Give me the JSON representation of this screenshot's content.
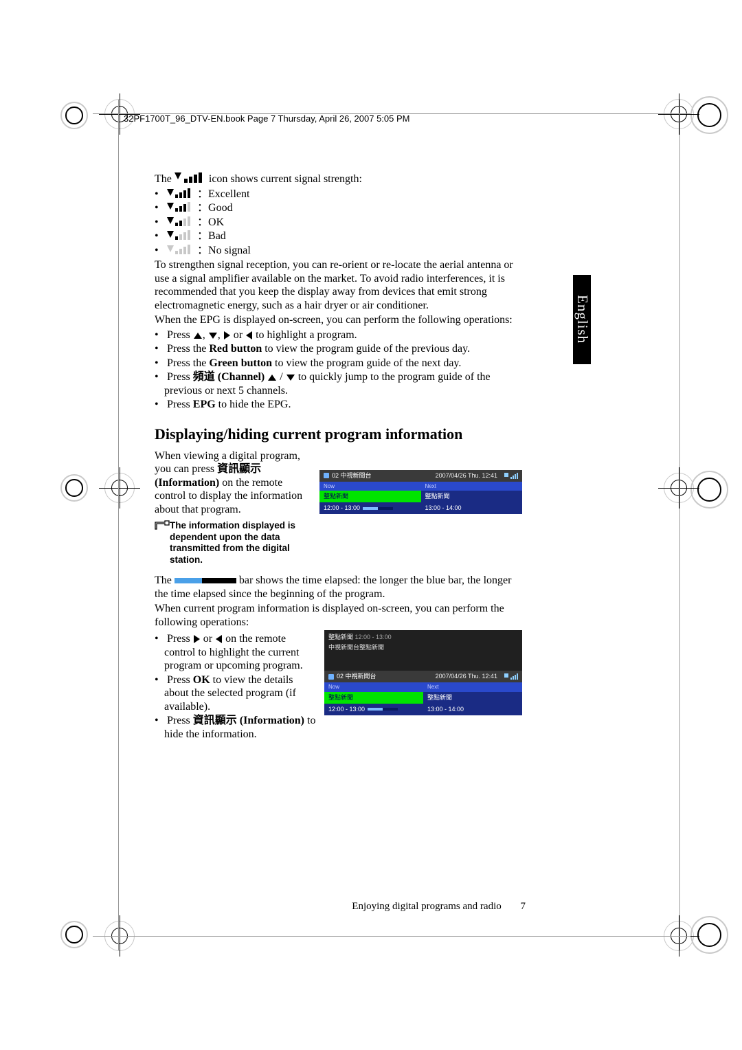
{
  "meta": {
    "book_header": "32PF1700T_96_DTV-EN.book  Page 7  Thursday, April 26, 2007  5:05 PM",
    "side_tab": "English",
    "footer_text": "Enjoying digital programs and radio",
    "page_number": "7"
  },
  "signal": {
    "intro_a": "The ",
    "intro_b": " icon shows current signal strength:",
    "levels": {
      "excellent": "Excellent",
      "good": "Good",
      "ok": "OK",
      "bad": "Bad",
      "none": "No signal"
    },
    "reception": "To strengthen signal reception, you can re-orient or re-locate the aerial antenna or use a signal amplifier available on the market. To avoid radio interferences, it is recommended that you keep the display away from devices that emit strong electromagnetic energy, such as a hair dryer or air conditioner."
  },
  "epg": {
    "intro": "When the EPG is displayed on-screen, you can perform the following operations:",
    "op_press": "Press ",
    "op_highlight_tail": " to highlight a program.",
    "op_red_a": "Press the ",
    "op_red_b": "Red button",
    "op_red_c": " to view the program guide of the previous day.",
    "op_green_a": "Press the ",
    "op_green_b": "Green button",
    "op_green_c": " to view the program guide of the next day.",
    "op_channel_a": "Press ",
    "op_channel_b": "頻道 (Channel) ",
    "op_channel_c": " to quickly jump to the program guide of the previous or next 5 channels.",
    "op_epg_a": "Press ",
    "op_epg_b": "EPG",
    "op_epg_c": " to hide the EPG."
  },
  "section_heading": "Displaying/hiding current program information",
  "info": {
    "p1_a": "When viewing a digital program, you can press ",
    "p1_b": "資訊顯示 (Information)",
    "p1_c": " on the remote control to display the information about that program.",
    "note": "The information displayed is dependent upon the data transmitted from the digital station.",
    "p2_a": "The ",
    "p2_b": " bar shows the time elapsed: the longer the blue bar, the longer the time elapsed since the beginning of the program.",
    "p3": "When current program information is displayed on-screen, you can perform the following operations:",
    "op1_a": "Press ",
    "op1_b": " on the remote control to highlight the current program or upcoming program.",
    "op2_a": "Press ",
    "op2_b": "OK",
    "op2_c": " to view the details about the selected program (if available).",
    "op3_a": "Press ",
    "op3_b": "資訊顯示 (Information)",
    "op3_c": " to hide the information."
  },
  "osd1": {
    "channel": "02 中視新聞台",
    "datetime": "2007/04/26 Thu. 12:41",
    "now_label": "Now",
    "next_label": "Next",
    "now_title": "整點新聞",
    "next_title": "整點新聞",
    "now_time": "12:00 - 13:00",
    "next_time": "13:00 - 14:00"
  },
  "osd2": {
    "detail_title": "整點新聞",
    "detail_time": "12:00 - 13:00",
    "detail_line2": "中視新聞台整點新聞",
    "channel": "02 中視新聞台",
    "datetime": "2007/04/26 Thu. 12:41",
    "now_label": "Now",
    "next_label": "Next",
    "now_title": "整點新聞",
    "next_title": "整點新聞",
    "now_time": "12:00 - 13:00",
    "next_time": "13:00 - 14:00"
  }
}
